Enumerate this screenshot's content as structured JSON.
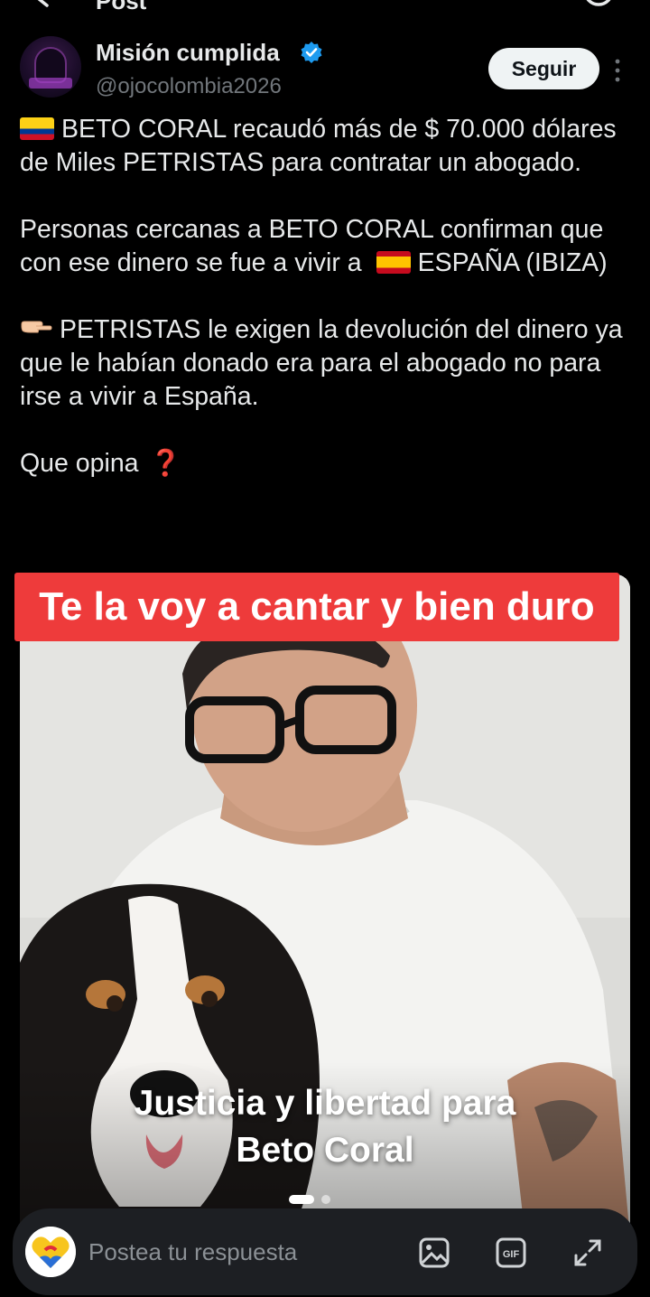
{
  "colors": {
    "background": "#000000",
    "text": "#e7e9ea",
    "muted": "#71767b",
    "verified": "#1d9bf0",
    "banner": "#ee3b3b",
    "follow_button_bg": "#eff3f4"
  },
  "topbar": {
    "back_icon": "back-arrow-icon",
    "title": "Post",
    "right_icon": "refresh-icon"
  },
  "author": {
    "name": "Misión cumplida",
    "handle": "@ojocolombia2026",
    "verified_icon": "verified-badge-icon",
    "follow_label": "Seguir",
    "more_icon": "more-vertical-icon"
  },
  "post": {
    "paragraph1": "BETO CORAL recaudó más de $ 70.000 dólares de Miles PETRISTAS para contratar un abogado.",
    "paragraph2_a": "Personas cercanas a BETO CORAL confirman que con ese dinero se fue a vivir a",
    "paragraph2_b": "ESPAÑA (IBIZA)",
    "paragraph3": "PETRISTAS le exigen la devolución del dinero ya que le habían donado era para el abogado no para irse a vivir a España.",
    "paragraph4": "Que opina",
    "question_glyph": "❓"
  },
  "overlay": {
    "banner_text": "Te la voy a cantar y bien duro"
  },
  "media": {
    "caption_line1": "Justicia y libertad para",
    "caption_line2": "Beto Coral",
    "page_count": 2,
    "active_page": 1
  },
  "reply": {
    "placeholder": "Postea tu respuesta",
    "icons": [
      "image-icon",
      "gif-icon",
      "expand-icon"
    ]
  }
}
